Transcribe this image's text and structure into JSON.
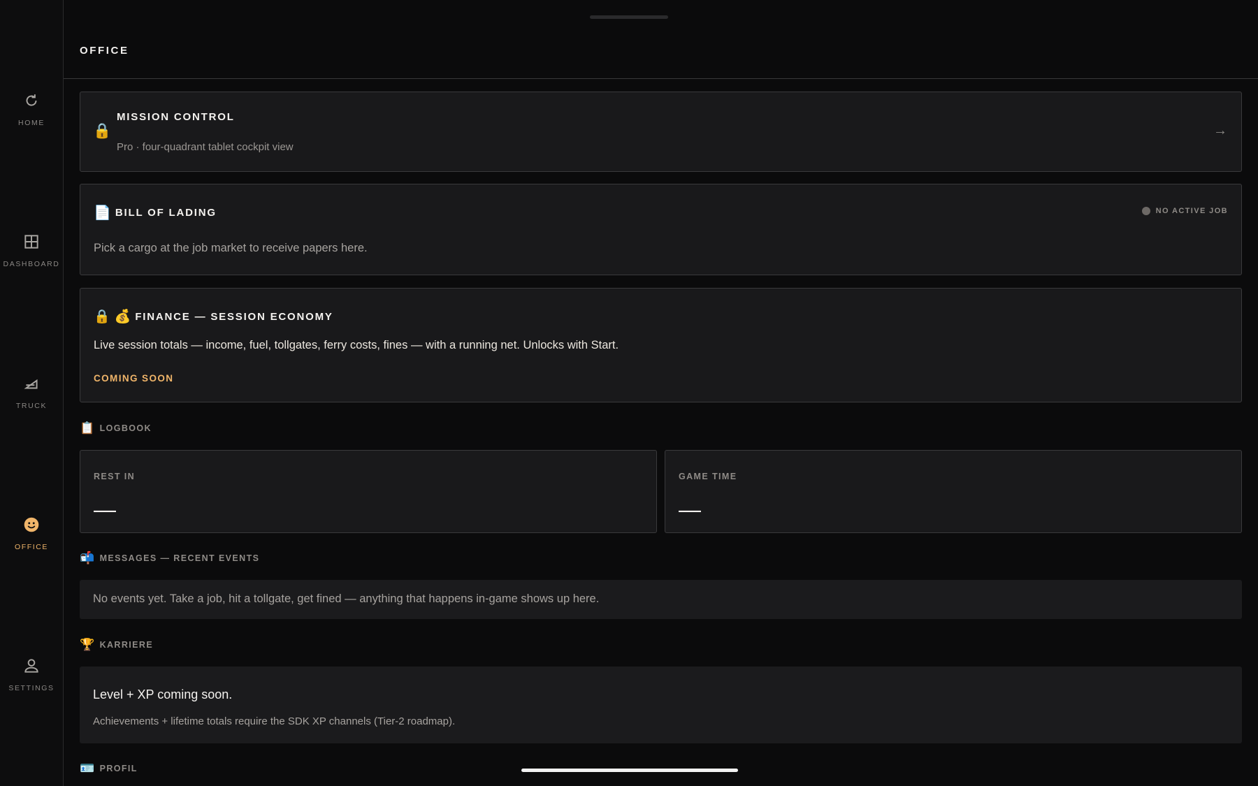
{
  "sidebar": {
    "items": [
      {
        "label": "HOME",
        "icon": "refresh-icon"
      },
      {
        "label": "DASHBOARD",
        "icon": "grid-icon"
      },
      {
        "label": "TRUCK",
        "icon": "ramp-icon"
      },
      {
        "label": "OFFICE",
        "icon": "smiley-icon"
      },
      {
        "label": "SETTINGS",
        "icon": "person-icon"
      }
    ],
    "active": "OFFICE"
  },
  "header": {
    "title": "OFFICE"
  },
  "mission_control": {
    "title": "MISSION CONTROL",
    "subtitle": "Pro · four-quadrant tablet cockpit view",
    "lock_glyph": "🔒",
    "arrow_glyph": "→"
  },
  "bill_of_lading": {
    "icon_glyph": "📄",
    "title": "BILL OF LADING",
    "status": "NO ACTIVE JOB",
    "body": "Pick a cargo at the job market to receive papers here."
  },
  "finance": {
    "lock_glyph": "🔒",
    "money_glyph": "💰",
    "title": "FINANCE — SESSION ECONOMY",
    "body": "Live session totals — income, fuel, tollgates, ferry costs, fines — with a running net. Unlocks with Start.",
    "badge": "COMING SOON"
  },
  "logbook": {
    "icon_glyph": "📋",
    "heading": "LOGBOOK",
    "rest": {
      "label": "REST IN",
      "value": "—"
    },
    "game_time": {
      "label": "GAME TIME",
      "value": "—"
    }
  },
  "messages": {
    "icon_glyph": "📬",
    "heading": "MESSAGES — RECENT EVENTS",
    "body": "No events yet. Take a job, hit a tollgate, get fined — anything that happens in-game shows up here."
  },
  "career": {
    "icon_glyph": "🏆",
    "heading": "KARRIERE",
    "title": "Level + XP coming soon.",
    "body": "Achievements + lifetime totals require the SDK XP channels (Tier-2 roadmap)."
  },
  "profile": {
    "icon_glyph": "🪪",
    "heading": "PROFIL"
  },
  "colors": {
    "accent": "#f0b56a",
    "background": "#0b0b0c",
    "card": "#19191b",
    "border": "#3a3a3c"
  }
}
